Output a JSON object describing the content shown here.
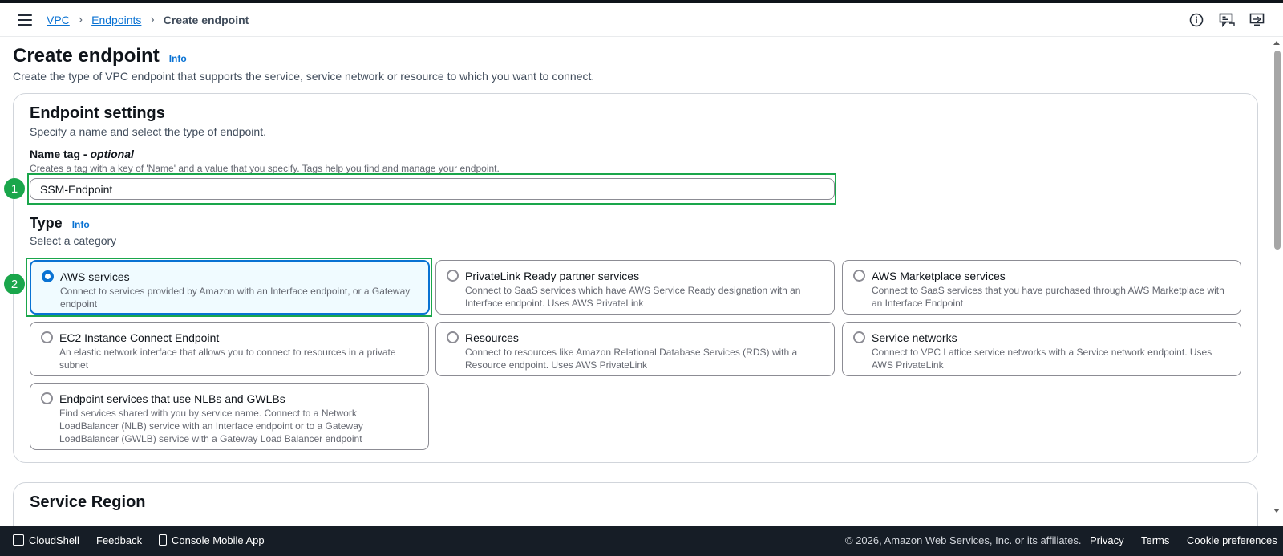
{
  "breadcrumb": {
    "items": [
      "VPC",
      "Endpoints"
    ],
    "current": "Create endpoint"
  },
  "icons": {
    "menu": "hamburger-icon",
    "info": "info-circle-icon",
    "feedback": "feedback-icon",
    "screen": "screen-icon"
  },
  "page": {
    "title": "Create endpoint",
    "info": "Info",
    "description": "Create the type of VPC endpoint that supports the service, service network or resource to which you want to connect."
  },
  "endpoint_settings": {
    "title": "Endpoint settings",
    "description": "Specify a name and select the type of endpoint.",
    "name_tag_label": "Name tag - ",
    "name_tag_optional": "optional",
    "name_tag_description": "Creates a tag with a key of 'Name' and a value that you specify. Tags help you find and manage your endpoint.",
    "name_tag_value": "SSM-Endpoint"
  },
  "type_section": {
    "title": "Type",
    "info": "Info",
    "description": "Select a category",
    "options": [
      {
        "title": "AWS services",
        "description": "Connect to services provided by Amazon with an Interface endpoint, or a Gateway endpoint",
        "selected": true
      },
      {
        "title": "PrivateLink Ready partner services",
        "description": "Connect to SaaS services which have AWS Service Ready designation with an Interface endpoint. Uses AWS PrivateLink",
        "selected": false
      },
      {
        "title": "AWS Marketplace services",
        "description": "Connect to SaaS services that you have purchased through AWS Marketplace with an Interface Endpoint",
        "selected": false
      },
      {
        "title": "EC2 Instance Connect Endpoint",
        "description": "An elastic network interface that allows you to connect to resources in a private subnet",
        "selected": false
      },
      {
        "title": "Resources",
        "description": "Connect to resources like Amazon Relational Database Services (RDS) with a Resource endpoint. Uses AWS PrivateLink",
        "selected": false
      },
      {
        "title": "Service networks",
        "description": "Connect to VPC Lattice service networks with a Service network endpoint. Uses AWS PrivateLink",
        "selected": false
      },
      {
        "title": "Endpoint services that use NLBs and GWLBs",
        "description": "Find services shared with you by service name. Connect to a Network LoadBalancer (NLB) service with an Interface endpoint or to a Gateway LoadBalancer (GWLB) service with a Gateway Load Balancer endpoint",
        "selected": false
      }
    ]
  },
  "annotations": {
    "step1": "1",
    "step2": "2",
    "color": "#1aa64b"
  },
  "service_region": {
    "title": "Service Region"
  },
  "footer": {
    "cloudshell": "CloudShell",
    "feedback": "Feedback",
    "mobile_app": "Console Mobile App",
    "copyright": "© 2026, Amazon Web Services, Inc. or its affiliates.",
    "privacy": "Privacy",
    "terms": "Terms",
    "cookies": "Cookie preferences"
  },
  "colors": {
    "accent": "#0972d3",
    "footer_bg": "#161d26",
    "selected_bg": "#f0fbff"
  }
}
